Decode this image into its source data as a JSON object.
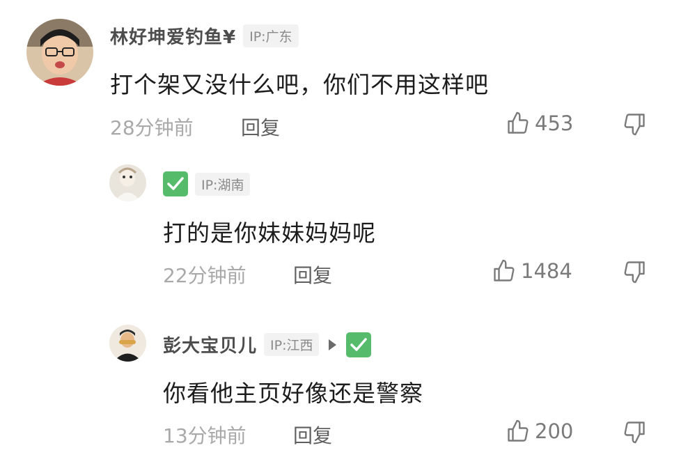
{
  "comments": [
    {
      "username": "林好坤爱钓鱼¥",
      "ip": "IP:广东",
      "text": "打个架又没什么吧，你们不用这样吧",
      "time": "28分钟前",
      "reply": "回复",
      "likes": "453"
    },
    {
      "username": "",
      "verified_icon": "check-icon",
      "ip": "IP:湖南",
      "text": "打的是你妹妹妈妈呢",
      "time": "22分钟前",
      "reply": "回复",
      "likes": "1484"
    },
    {
      "username": "彭大宝贝儿",
      "ip": "IP:江西",
      "verified_icon": "check-icon",
      "text": "你看他主页好像还是警察",
      "time": "13分钟前",
      "reply": "回复",
      "likes": "200"
    }
  ],
  "icons": {
    "like": "thumbs-up-icon",
    "dislike": "thumbs-down-icon",
    "reply_to": "play-arrow-icon"
  },
  "colors": {
    "verified_badge": "#57bb6c",
    "ip_badge_bg": "#f2f2f2",
    "meta_text": "#a9a9a9"
  }
}
